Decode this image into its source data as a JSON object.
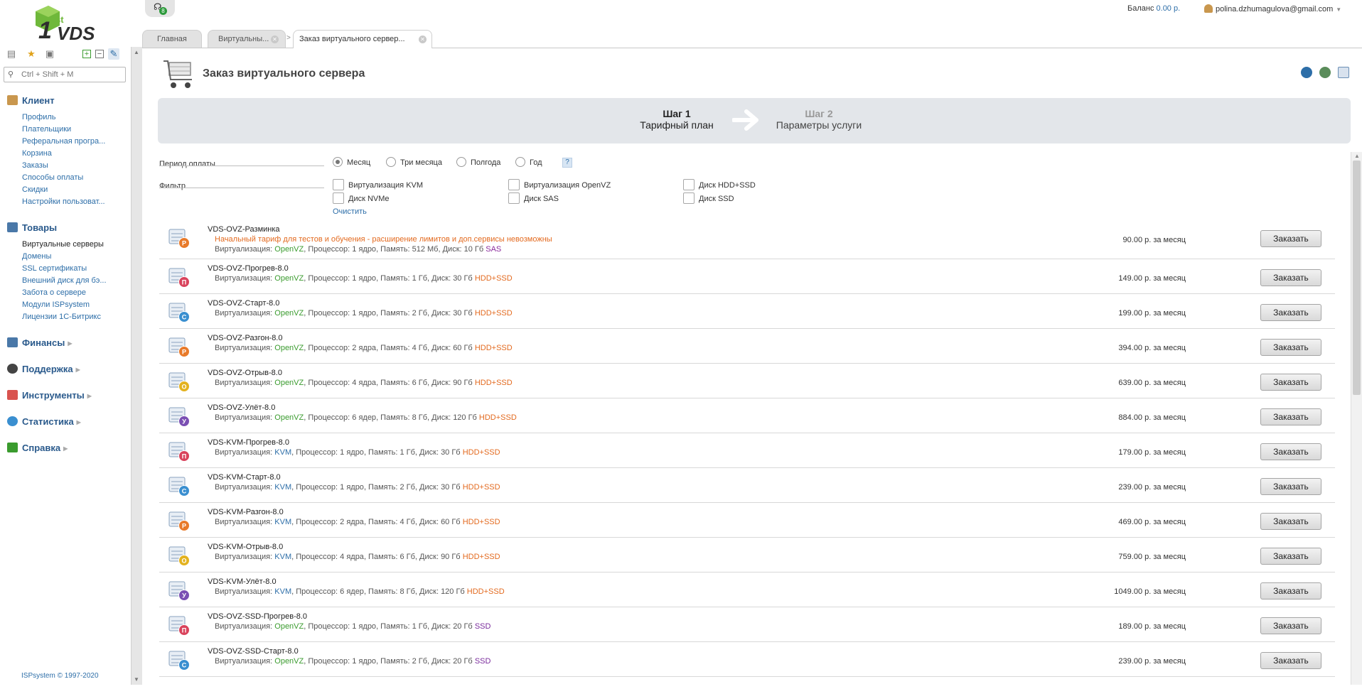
{
  "logo": {
    "top_text": "st",
    "main_text": "VDS",
    "number": "1"
  },
  "search": {
    "placeholder": "Ctrl + Shift + M"
  },
  "top": {
    "notify_count": "8",
    "balance_label": "Баланс",
    "balance_value": "0.00 р.",
    "user_email": "polina.dzhumagulova@gmail.com"
  },
  "tabs": [
    {
      "label": "Главная"
    },
    {
      "label": "Виртуальны..."
    },
    {
      "label": "Заказ виртуального сервер..."
    }
  ],
  "sidebar": {
    "groups": [
      {
        "label": "Клиент",
        "items": [
          "Профиль",
          "Плательщики",
          "Реферальная програ...",
          "Корзина",
          "Заказы",
          "Способы оплаты",
          "Скидки",
          "Настройки пользоват..."
        ]
      },
      {
        "label": "Товары",
        "items": [
          "Виртуальные серверы",
          "Домены",
          "SSL сертификаты",
          "Внешний диск для бэ...",
          "Забота о сервере",
          "Модули ISPsystem",
          "Лицензии 1С-Битрикс"
        ]
      },
      {
        "label": "Финансы"
      },
      {
        "label": "Поддержка"
      },
      {
        "label": "Инструменты"
      },
      {
        "label": "Статистика"
      },
      {
        "label": "Справка"
      }
    ],
    "copyright": "ISPsystem © 1997-2020"
  },
  "page": {
    "title": "Заказ виртуального сервера"
  },
  "steps": [
    {
      "title": "Шаг 1",
      "subtitle": "Тарифный план"
    },
    {
      "title": "Шаг 2",
      "subtitle": "Параметры услуги"
    }
  ],
  "form": {
    "period_label": "Период оплаты",
    "period_options": [
      "Месяц",
      "Три месяца",
      "Полгода",
      "Год"
    ],
    "period_selected": "Месяц",
    "help": "?",
    "filter_label": "Фильтр",
    "filters": [
      "Виртуализация KVM",
      "Виртуализация OpenVZ",
      "Диск HDD+SSD",
      "Диск NVMe",
      "Диск SAS",
      "Диск SSD"
    ],
    "clear": "Очистить"
  },
  "spec_labels": {
    "virt": "Виртуализация: ",
    "cpu": ", Процессор: ",
    "mem": ", Память: ",
    "disk": ", Диск: "
  },
  "plans": [
    {
      "name": "VDS-OVZ-Разминка",
      "note": "Начальный тариф для тестов и обучения - расширение лимитов и доп.сервисы невозможны",
      "virt": "OpenVZ",
      "cpu": "1 ядро",
      "mem": "512 Мб",
      "disk": "10 Гб",
      "disk_type": "SAS",
      "price": "90.00 р. за месяц",
      "button": "Заказать",
      "letter": "Р"
    },
    {
      "name": "VDS-OVZ-Прогрев-8.0",
      "virt": "OpenVZ",
      "cpu": "1 ядро",
      "mem": "1 Гб",
      "disk": "30 Гб",
      "disk_type": "HDD+SSD",
      "price": "149.00 р. за месяц",
      "button": "Заказать",
      "letter": "П"
    },
    {
      "name": "VDS-OVZ-Старт-8.0",
      "virt": "OpenVZ",
      "cpu": "1 ядро",
      "mem": "2 Гб",
      "disk": "30 Гб",
      "disk_type": "HDD+SSD",
      "price": "199.00 р. за месяц",
      "button": "Заказать",
      "letter": "С"
    },
    {
      "name": "VDS-OVZ-Разгон-8.0",
      "virt": "OpenVZ",
      "cpu": "2 ядра",
      "mem": "4 Гб",
      "disk": "60 Гб",
      "disk_type": "HDD+SSD",
      "price": "394.00 р. за месяц",
      "button": "Заказать",
      "letter": "Р"
    },
    {
      "name": "VDS-OVZ-Отрыв-8.0",
      "virt": "OpenVZ",
      "cpu": "4 ядра",
      "mem": "6 Гб",
      "disk": "90 Гб",
      "disk_type": "HDD+SSD",
      "price": "639.00 р. за месяц",
      "button": "Заказать",
      "letter": "О"
    },
    {
      "name": "VDS-OVZ-Улёт-8.0",
      "virt": "OpenVZ",
      "cpu": "6 ядер",
      "mem": "8 Гб",
      "disk": "120 Гб",
      "disk_type": "HDD+SSD",
      "price": "884.00 р. за месяц",
      "button": "Заказать",
      "letter": "У"
    },
    {
      "name": "VDS-KVM-Прогрев-8.0",
      "virt": "KVM",
      "cpu": "1 ядро",
      "mem": "1 Гб",
      "disk": "30 Гб",
      "disk_type": "HDD+SSD",
      "price": "179.00 р. за месяц",
      "button": "Заказать",
      "letter": "П"
    },
    {
      "name": "VDS-KVM-Старт-8.0",
      "virt": "KVM",
      "cpu": "1 ядро",
      "mem": "2 Гб",
      "disk": "30 Гб",
      "disk_type": "HDD+SSD",
      "price": "239.00 р. за месяц",
      "button": "Заказать",
      "letter": "С"
    },
    {
      "name": "VDS-KVM-Разгон-8.0",
      "virt": "KVM",
      "cpu": "2 ядра",
      "mem": "4 Гб",
      "disk": "60 Гб",
      "disk_type": "HDD+SSD",
      "price": "469.00 р. за месяц",
      "button": "Заказать",
      "letter": "Р"
    },
    {
      "name": "VDS-KVM-Отрыв-8.0",
      "virt": "KVM",
      "cpu": "4 ядра",
      "mem": "6 Гб",
      "disk": "90 Гб",
      "disk_type": "HDD+SSD",
      "price": "759.00 р. за месяц",
      "button": "Заказать",
      "letter": "О"
    },
    {
      "name": "VDS-KVM-Улёт-8.0",
      "virt": "KVM",
      "cpu": "6 ядер",
      "mem": "8 Гб",
      "disk": "120 Гб",
      "disk_type": "HDD+SSD",
      "price": "1049.00 р. за месяц",
      "button": "Заказать",
      "letter": "У"
    },
    {
      "name": "VDS-OVZ-SSD-Прогрев-8.0",
      "virt": "OpenVZ",
      "cpu": "1 ядро",
      "mem": "1 Гб",
      "disk": "20 Гб",
      "disk_type": "SSD",
      "price": "189.00 р. за месяц",
      "button": "Заказать",
      "letter": "П"
    },
    {
      "name": "VDS-OVZ-SSD-Старт-8.0",
      "virt": "OpenVZ",
      "cpu": "1 ядро",
      "mem": "2 Гб",
      "disk": "20 Гб",
      "disk_type": "SSD",
      "price": "239.00 р. за месяц",
      "button": "Заказать",
      "letter": "С"
    }
  ],
  "colors": {
    "accent": "#2d6ea8",
    "ovz": "#3a9b2e",
    "kvm": "#2d6ea8",
    "hdd_ssd": "#e36a1f",
    "ssd": "#7a2b9c",
    "note": "#e36a1f"
  }
}
